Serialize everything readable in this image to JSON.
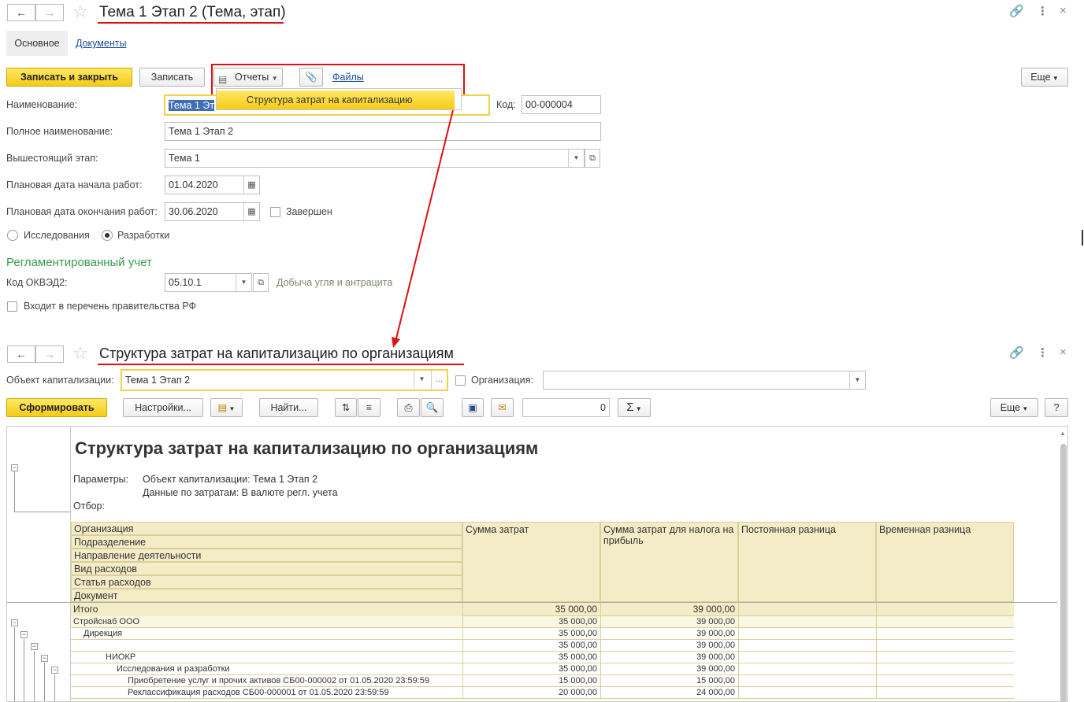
{
  "form1": {
    "title": "Тема 1 Этап 2 (Тема, этап)",
    "tabs": [
      "Основное",
      "Документы"
    ],
    "toolbar": {
      "save_close": "Записать и закрыть",
      "save": "Записать",
      "reports": "Отчеты",
      "files": "Файлы",
      "more": "Еще"
    },
    "reports_menu_item": "Структура затрат на капитализацию",
    "fields": {
      "name_label": "Наименование:",
      "name_value": "Тема 1 Эт",
      "code_label": "Код:",
      "code_value": "00-000004",
      "fullname_label": "Полное наименование:",
      "fullname_value": "Тема 1 Этап 2",
      "parent_label": "Вышестоящий этап:",
      "parent_value": "Тема 1",
      "start_label": "Плановая дата начала работ:",
      "start_value": "01.04.2020",
      "end_label": "Плановая дата окончания работ:",
      "end_value": "30.06.2020",
      "completed_label": "Завершен",
      "radio_research": "Исследования",
      "radio_development": "Разработки",
      "selected_radio": "Разработки"
    },
    "reg_section": "Регламентированный учет",
    "okved_label": "Код ОКВЭД2:",
    "okved_value": "05.10.1",
    "okved_desc": "Добыча угля и антрацита",
    "gov_list_label": "Входит в перечень правительства РФ"
  },
  "form2": {
    "title": "Структура затрат на капитализацию по организациям",
    "object_label": "Объект капитализации:",
    "object_value": "Тема 1 Этап 2",
    "org_label": "Организация:",
    "org_value": "",
    "toolbar": {
      "generate": "Сформировать",
      "settings": "Настройки...",
      "find": "Найти...",
      "sum_value": "0",
      "sigma": "Σ",
      "more": "Еще",
      "help": "?"
    },
    "report": {
      "title": "Структура затрат на капитализацию по организациям",
      "params_label": "Параметры:",
      "param1": "Объект капитализации: Тема 1 Этап 2",
      "param2": "Данные по затратам: В валюте регл. учета",
      "filter_label": "Отбор:",
      "group_headers": [
        "Организация",
        "Подразделение",
        "Направление деятельности",
        "Вид расходов",
        "Статья расходов",
        "Документ"
      ],
      "col_headers": [
        "Сумма затрат",
        "Сумма затрат для налога на прибыль",
        "Постоянная разница",
        "Временная разница"
      ],
      "total": {
        "label": "Итого",
        "sum": "35 000,00",
        "tax": "39 000,00"
      },
      "rows": [
        {
          "label": "Стройснаб ООО",
          "sum": "35 000,00",
          "tax": "39 000,00"
        },
        {
          "label": "Дирекция",
          "sum": "35 000,00",
          "tax": "39 000,00"
        },
        {
          "label": "",
          "sum": "35 000,00",
          "tax": "39 000,00"
        },
        {
          "label": "НИОКР",
          "sum": "35 000,00",
          "tax": "39 000,00"
        },
        {
          "label": "Исследования и разработки",
          "sum": "35 000,00",
          "tax": "39 000,00"
        },
        {
          "label": "Приобретение услуг и прочих активов СБ00-000002 от 01.05.2020 23:59:59",
          "sum": "15 000,00",
          "tax": "15 000,00"
        },
        {
          "label": "Реклассификация расходов СБ00-000001 от 01.05.2020 23:59:59",
          "sum": "20 000,00",
          "tax": "24 000,00"
        }
      ]
    }
  },
  "colors": {
    "accent_yellow": "#f4cb16",
    "annotation_red": "#d11111",
    "section_green": "#3a9b4b",
    "report_header": "#f3ecc7"
  }
}
